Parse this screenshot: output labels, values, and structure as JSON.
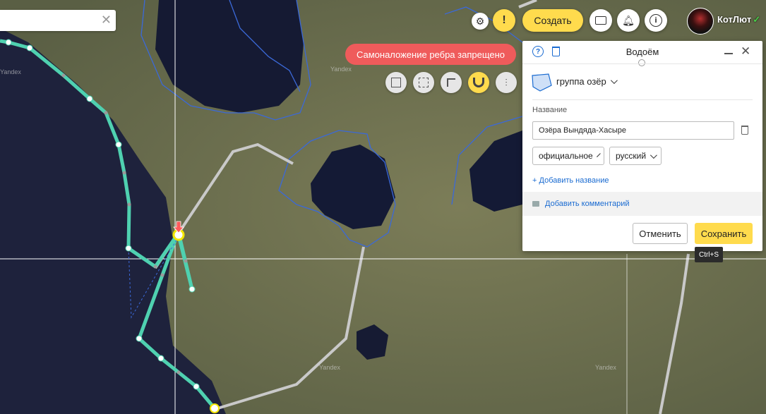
{
  "colors": {
    "accent": "#ffdb4d",
    "error": "#ef5b5b",
    "edge": "#4fd1b0",
    "road": "#c8c8c8",
    "water": "#1f2440",
    "land": "#6f7350",
    "link": "#1a6bd1"
  },
  "search": {
    "placeholder": ""
  },
  "header": {
    "settings_icon": "gear-icon",
    "alert_icon": "exclamation-icon",
    "create_label": "Создать",
    "user_name": "КотЛют",
    "verified_icon": "check-icon"
  },
  "error_toast": {
    "text": "Самоналожение ребра запрещено"
  },
  "tools": [
    "add-shape-icon",
    "select-area-icon",
    "corner-icon",
    "magnet-icon",
    "sliders-icon"
  ],
  "map": {
    "watermarks": [
      "Yandex",
      "Yandex",
      "Yandex",
      "Yandex"
    ]
  },
  "panel": {
    "title": "Водоём",
    "category_label": "группа озёр",
    "name_section_label": "Название",
    "name_value": "Озёра Вындяда-Хасыре",
    "name_type": "официальное",
    "name_lang": "русский",
    "add_name_label": "Добавить название",
    "add_comment_label": "Добавить комментарий",
    "cancel_label": "Отменить",
    "save_label": "Сохранить",
    "save_tooltip": "Ctrl+S"
  }
}
